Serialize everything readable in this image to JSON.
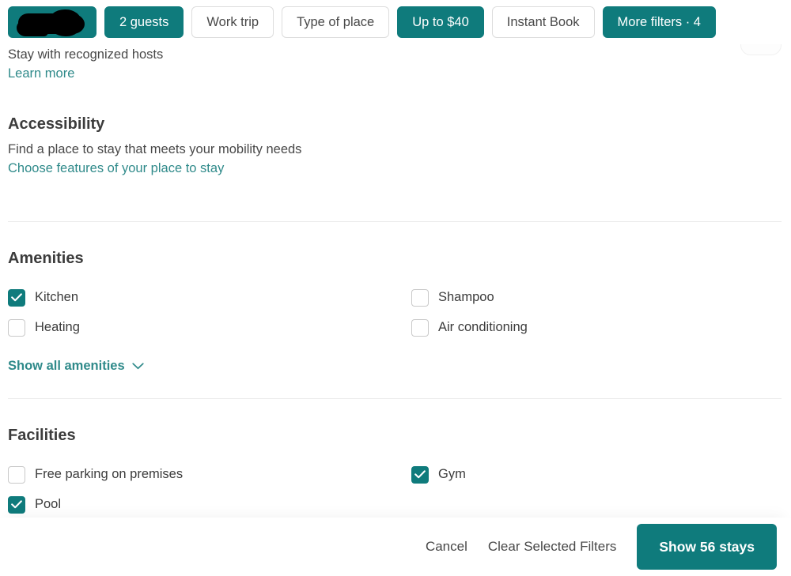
{
  "filter_bar": {
    "pills": [
      {
        "label": "",
        "style": "solid",
        "redacted": true,
        "name": "filter-pill-redacted"
      },
      {
        "label": "2 guests",
        "style": "solid",
        "redacted": false,
        "name": "filter-pill-guests"
      },
      {
        "label": "Work trip",
        "style": "outline",
        "redacted": false,
        "name": "filter-pill-work-trip"
      },
      {
        "label": "Type of place",
        "style": "outline",
        "redacted": false,
        "name": "filter-pill-type-of-place"
      },
      {
        "label": "Up to $40",
        "style": "solid",
        "redacted": false,
        "name": "filter-pill-price"
      },
      {
        "label": "Instant Book",
        "style": "outline",
        "redacted": false,
        "name": "filter-pill-instant-book"
      },
      {
        "label": "More filters · 4",
        "style": "solid",
        "redacted": false,
        "name": "filter-pill-more-filters"
      }
    ]
  },
  "recognized_hosts": {
    "text": "Stay with recognized hosts",
    "link": "Learn more"
  },
  "accessibility": {
    "title": "Accessibility",
    "subtitle": "Find a place to stay that meets your mobility needs",
    "link": "Choose features of your place to stay"
  },
  "amenities": {
    "title": "Amenities",
    "items": [
      {
        "label": "Kitchen",
        "checked": true
      },
      {
        "label": "Shampoo",
        "checked": false
      },
      {
        "label": "Heating",
        "checked": false
      },
      {
        "label": "Air conditioning",
        "checked": false
      }
    ],
    "show_all_label": "Show all amenities"
  },
  "facilities": {
    "title": "Facilities",
    "items": [
      {
        "label": "Free parking on premises",
        "checked": false
      },
      {
        "label": "Gym",
        "checked": true
      },
      {
        "label": "Pool",
        "checked": false,
        "checked_override": true
      }
    ]
  },
  "footer": {
    "cancel": "Cancel",
    "clear": "Clear Selected Filters",
    "show_results": "Show 56 stays"
  },
  "colors": {
    "accent": "#0f7b7c",
    "link": "#2f8a8a",
    "text": "#3c3c3c",
    "muted": "#484848",
    "border": "#dddddd",
    "divider": "#ebebeb"
  },
  "icons": {
    "chevron_down": "chevron-down-icon",
    "check": "check-icon"
  }
}
